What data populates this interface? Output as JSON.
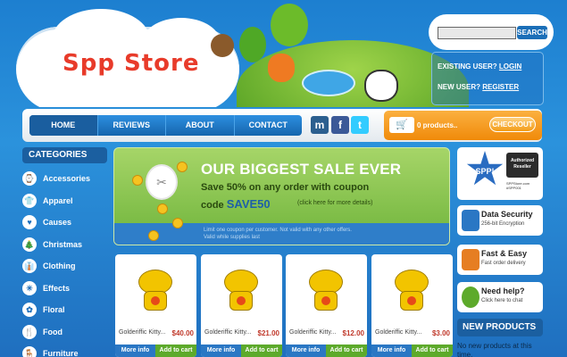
{
  "search": {
    "placeholder": "",
    "button": "SEARCH"
  },
  "account": {
    "existing_prefix": "EXISTING USER?",
    "existing_link": "LOGIN",
    "new_prefix": "NEW USER?",
    "new_link": "REGISTER"
  },
  "logo": {
    "text": "Spp Store"
  },
  "nav": {
    "items": [
      "HOME",
      "REVIEWS",
      "ABOUT",
      "CONTACT"
    ]
  },
  "social": [
    {
      "name": "myspace",
      "glyph": "m",
      "color": "#2b5f8f"
    },
    {
      "name": "facebook",
      "glyph": "f",
      "color": "#3b5998"
    },
    {
      "name": "twitter",
      "glyph": "t",
      "color": "#33ccff"
    }
  ],
  "cart": {
    "count_text": "0 products..",
    "checkout": "CHECKOUT"
  },
  "categories": {
    "title": "CATEGORIES",
    "items": [
      {
        "label": "Accessories",
        "icon": "⌚"
      },
      {
        "label": "Apparel",
        "icon": "👕"
      },
      {
        "label": "Causes",
        "icon": "♥"
      },
      {
        "label": "Christmas",
        "icon": "🎄"
      },
      {
        "label": "Clothing",
        "icon": "👔"
      },
      {
        "label": "Effects",
        "icon": "✳"
      },
      {
        "label": "Floral",
        "icon": "✿"
      },
      {
        "label": "Food",
        "icon": "🍴"
      },
      {
        "label": "Furniture",
        "icon": "🪑"
      }
    ]
  },
  "banner": {
    "title": "OUR BIGGEST SALE EVER",
    "line1": "Save 50% on any order with coupon",
    "code_prefix": "code",
    "code": "SAVE50",
    "click": "(click here for more details)",
    "note1": "Limit one coupon per customer. Not valid with any other offers.",
    "note2": "Valid while supplies last"
  },
  "products": [
    {
      "name": "Golderiffic Kitty...",
      "price": "$40.00",
      "more": "More info",
      "add": "Add to cart"
    },
    {
      "name": "Golderiffic Kitty...",
      "price": "$21.00",
      "more": "More info",
      "add": "Add to cart"
    },
    {
      "name": "Golderiffic Kitty...",
      "price": "$12.00",
      "more": "More info",
      "add": "Add to cart"
    },
    {
      "name": "Golderiffic Kitty...",
      "price": "$3.00",
      "more": "More info",
      "add": "Add to cart"
    }
  ],
  "sidebar_right": {
    "spp_badge": {
      "star_text": "SPP!",
      "seal_line1": "Authorized",
      "seal_line2": "Reseller",
      "small1": "SPPStore.com",
      "small2": "#SPP001"
    },
    "features": [
      {
        "title": "Data Security",
        "sub": "256-bit Encryption",
        "color": "#2a77c4"
      },
      {
        "title": "Fast & Easy",
        "sub": "Fast order delivery",
        "color": "#e67e22"
      },
      {
        "title": "Need help?",
        "sub": "Click here to chat",
        "color": "#5daa2b"
      }
    ],
    "new_products_title": "NEW PRODUCTS",
    "new_products_text": "No new products at this time."
  }
}
